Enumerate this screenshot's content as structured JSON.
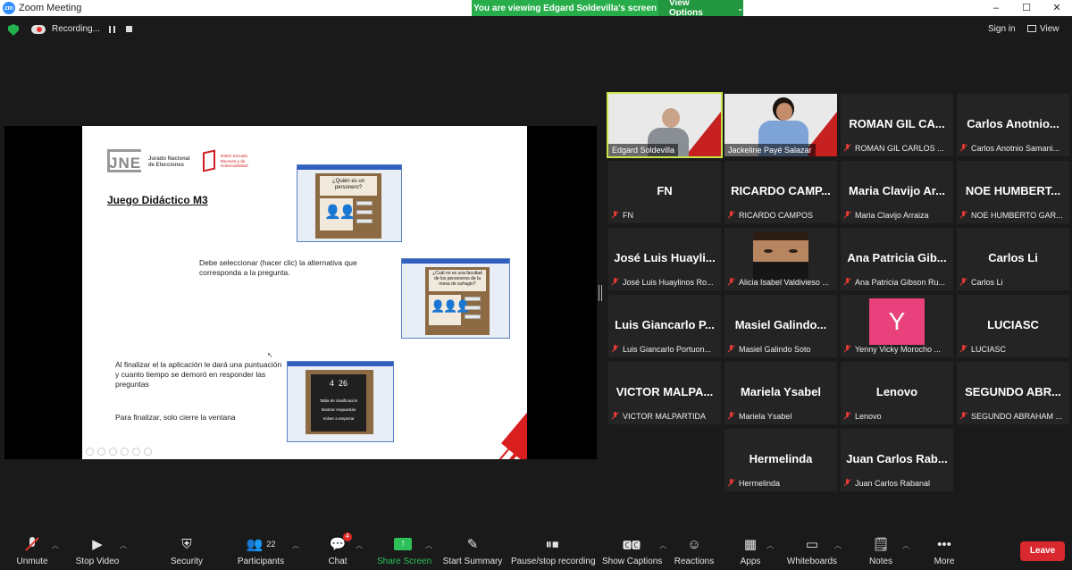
{
  "window": {
    "title": "Zoom Meeting",
    "app_badge": "zm",
    "controls": [
      "–",
      "☐",
      "✕"
    ]
  },
  "banner": {
    "message": "You are viewing Edgard Soldevilla's screen",
    "view_options": "View Options"
  },
  "recording": {
    "label": "Recording...",
    "sign_in": "Sign in",
    "view": "View"
  },
  "slide": {
    "logo_jne_main": "JNE",
    "logo_jne_text": "Jurado Nacional de Elecciones",
    "logo_eseg_text": "ESEG Escuela Electoral y de Gobernabilidad",
    "heading": "Juego Didáctico M3",
    "para1": "Debe seleccionar (hacer clic) la alternativa que corresponda a la pregunta.",
    "para2": "Al finalizar el la aplicación le dará una puntuación y cuanto tiempo se demoró en responder las preguntas",
    "para3": "Para finalizar, solo cierre la ventana",
    "thumb1_q": "¿Quién es un personero?",
    "thumb2_q": "¿Cuál no es una facultad de los personeros de la mesa de sufragio?",
    "thumb3_score1": "4",
    "thumb3_score2": "26",
    "thumb3_lines": [
      "Tabla de clasificación",
      "Mostrar respuestas",
      "Volver a empezar"
    ]
  },
  "participants": [
    {
      "display": "",
      "name": "Edgard Soldevilla",
      "video": "edgard",
      "muted": false,
      "active": true
    },
    {
      "display": "",
      "name": "Jackeline Payé Salazar",
      "video": "jackeline",
      "muted": false
    },
    {
      "display": "ROMAN GIL CA...",
      "name": "ROMAN GIL CARLOS ...",
      "muted": true
    },
    {
      "display": "Carlos Anotnio...",
      "name": "Carlos Anotnio Samani...",
      "muted": true
    },
    {
      "display": "FN",
      "name": "FN",
      "muted": true
    },
    {
      "display": "RICARDO CAMP...",
      "name": "RICARDO CAMPOS",
      "muted": true
    },
    {
      "display": "Maria Clavijo Ar...",
      "name": "Maria Clavijo Arraiza",
      "muted": true
    },
    {
      "display": "NOE HUMBERT...",
      "name": "NOE HUMBERTO GAR...",
      "muted": true
    },
    {
      "display": "José Luis Huayli...",
      "name": "José Luis Huaylinos Ro...",
      "muted": true
    },
    {
      "display": "",
      "name": "Alicia Isabel Valdivieso ...",
      "video": "alicia",
      "muted": true
    },
    {
      "display": "Ana Patricia Gib...",
      "name": "Ana Patricia Gibson Ru...",
      "muted": true
    },
    {
      "display": "Carlos Li",
      "name": "Carlos Li",
      "muted": true
    },
    {
      "display": "Luis Giancarlo P...",
      "name": "Luis Giancarlo Portuon...",
      "muted": true
    },
    {
      "display": "Masiel Galindo...",
      "name": "Masiel Galindo Soto",
      "muted": true
    },
    {
      "display": "Y",
      "name": "Yenny Vicky Morocho ...",
      "video": "avatar",
      "muted": true
    },
    {
      "display": "LUCIASC",
      "name": "LUCIASC",
      "muted": true
    },
    {
      "display": "VICTOR MALPA...",
      "name": "VICTOR MALPARTIDA",
      "muted": true
    },
    {
      "display": "Mariela Ysabel",
      "name": "Mariela Ysabel",
      "muted": true
    },
    {
      "display": "Lenovo",
      "name": "Lenovo",
      "muted": true
    },
    {
      "display": "SEGUNDO ABR...",
      "name": "SEGUNDO ABRAHAM ...",
      "muted": true
    },
    {
      "display": "Hermelinda",
      "name": "Hermelinda",
      "muted": true
    },
    {
      "display": "Juan Carlos Rab...",
      "name": "Juan Carlos Rabanal",
      "muted": true
    }
  ],
  "toolbar": {
    "unmute": "Unmute",
    "stop_video": "Stop Video",
    "security": "Security",
    "participants": "Participants",
    "participants_count": "22",
    "chat": "Chat",
    "chat_badge": "4",
    "share_screen": "Share Screen",
    "start_summary": "Start Summary",
    "pause_recording": "Pause/stop recording",
    "show_captions": "Show Captions",
    "reactions": "Reactions",
    "apps": "Apps",
    "whiteboards": "Whiteboards",
    "notes": "Notes",
    "more": "More",
    "leave": "Leave"
  },
  "colors": {
    "banner_green": "#27ae4a",
    "active_speaker": "#c8e64a",
    "leave_red": "#d9282e",
    "muted_red": "#e53935"
  }
}
